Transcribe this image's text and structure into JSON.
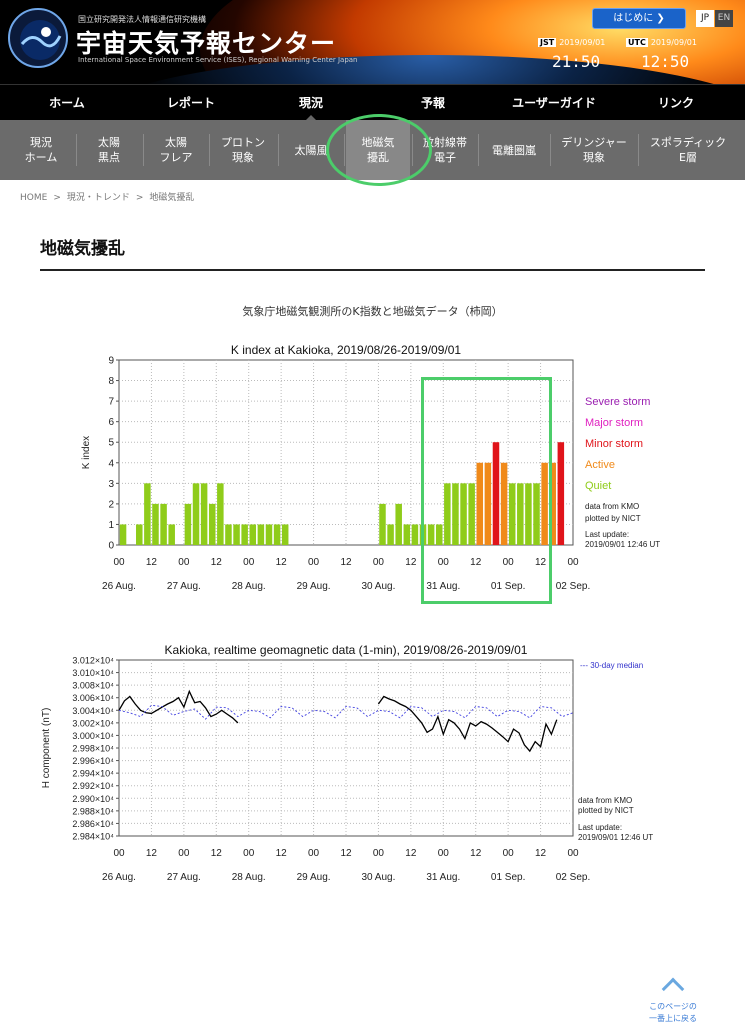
{
  "header": {
    "org": "国立研究開発法人情報通信研究機構",
    "title": "宇宙天気予報センター",
    "subtitle": "International Space Environment Service (ISES), Regional Warning Center Japan",
    "start_button": "はじめに",
    "lang_jp": "JP",
    "lang_en": "EN",
    "jst_tag": "JST",
    "jst_date": "2019/09/01",
    "jst_time": "21:50",
    "utc_tag": "UTC",
    "utc_date": "2019/09/01",
    "utc_time": "12:50"
  },
  "nav": [
    "ホーム",
    "レポート",
    "現況",
    "予報",
    "ユーザーガイド",
    "リンク"
  ],
  "subnav": [
    "現況\nホーム",
    "太陽\n黒点",
    "太陽\nフレア",
    "プロトン\n現象",
    "太陽風",
    "地磁気\n擾乱",
    "放射線帯\n電子",
    "電離圏嵐",
    "デリンジャー\n現象",
    "スポラディック\nE層"
  ],
  "breadcrumb": [
    "HOME",
    ">",
    "現況・トレンド",
    ">",
    "地磁気擾乱"
  ],
  "page_title": "地磁気擾乱",
  "caption": "気象庁地磁気観測所のK指数と地磁気データ（柿岡）",
  "scroll_top": [
    "このページの",
    "一番上に戻る"
  ],
  "chart_data": [
    {
      "type": "bar",
      "title": "K index at Kakioka, 2019/08/26-2019/09/01",
      "ylabel": "K index",
      "ylim": [
        0,
        9
      ],
      "yticks": [
        0,
        1,
        2,
        3,
        4,
        5,
        6,
        7,
        8,
        9
      ],
      "xticks": [
        "00",
        "12",
        "00",
        "12",
        "00",
        "12",
        "00",
        "12",
        "00",
        "12",
        "00",
        "12",
        "00",
        "12",
        "00"
      ],
      "days": [
        "26 Aug.",
        "27 Aug.",
        "28 Aug.",
        "29 Aug.",
        "30 Aug.",
        "31 Aug.",
        "01 Sep.",
        "02 Sep."
      ],
      "values": [
        1,
        0,
        1,
        3,
        2,
        2,
        1,
        0,
        2,
        3,
        3,
        2,
        3,
        1,
        1,
        1,
        1,
        1,
        1,
        1,
        1,
        0,
        0,
        0,
        0,
        0,
        0,
        0,
        0,
        0,
        0,
        0,
        2,
        1,
        2,
        1,
        1,
        1,
        1,
        1,
        3,
        3,
        3,
        3,
        4,
        4,
        5,
        4,
        3,
        3,
        3,
        3,
        4,
        4,
        5
      ],
      "levels": [
        {
          "name": "Severe storm",
          "color": "#9a1fb0"
        },
        {
          "name": "Major storm",
          "color": "#e020c0"
        },
        {
          "name": "Minor storm",
          "color": "#e0141a"
        },
        {
          "name": "Active",
          "color": "#f08a1a"
        },
        {
          "name": "Quiet",
          "color": "#8fcc1a"
        }
      ],
      "notes": [
        "data from KMO",
        "plotted by NICT",
        "Last update:",
        "2019/09/01 12:46 UT"
      ],
      "grid": true
    },
    {
      "type": "line",
      "title": "Kakioka, realtime geomagnetic data (1-min), 2019/08/26-2019/09/01",
      "ylabel": "H component (nT)",
      "ylim": [
        29840,
        30120
      ],
      "yticks": [
        "3.012×10⁴",
        "3.010×10⁴",
        "3.008×10⁴",
        "3.006×10⁴",
        "3.004×10⁴",
        "3.002×10⁴",
        "3.000×10⁴",
        "2.998×10⁴",
        "2.996×10⁴",
        "2.994×10⁴",
        "2.992×10⁴",
        "2.990×10⁴",
        "2.988×10⁴",
        "2.986×10⁴",
        "2.984×10⁴"
      ],
      "xticks": [
        "00",
        "12",
        "00",
        "12",
        "00",
        "12",
        "00",
        "12",
        "00",
        "12",
        "00",
        "12",
        "00",
        "12",
        "00"
      ],
      "days": [
        "26 Aug.",
        "27 Aug.",
        "28 Aug.",
        "29 Aug.",
        "30 Aug.",
        "31 Aug.",
        "01 Sep.",
        "02 Sep."
      ],
      "legend": "--- 30-day median",
      "series": [
        {
          "x": [
            0,
            2,
            4,
            6,
            8,
            10,
            12,
            14,
            16,
            18,
            20,
            22,
            24,
            26,
            28,
            30,
            32,
            34,
            36,
            38,
            40,
            42,
            44,
            46,
            48,
            50,
            52,
            54,
            56,
            58,
            60,
            62,
            64,
            66,
            68,
            70,
            72,
            74,
            76,
            78,
            80,
            82,
            84,
            86,
            88,
            90,
            92,
            94,
            96,
            98,
            100,
            102,
            104,
            106,
            108,
            110,
            112,
            114,
            116,
            118,
            120,
            122,
            124,
            126,
            128,
            130,
            132,
            134,
            136,
            138,
            140,
            142,
            144,
            146,
            148,
            150,
            152,
            154,
            156,
            158,
            160,
            162,
            164,
            166
          ],
          "values": [
            30040,
            30055,
            30062,
            30050,
            30040,
            30036,
            30035,
            30040,
            30045,
            30050,
            30054,
            30060,
            30045,
            30070,
            30052,
            30054,
            30044,
            30030,
            30034,
            30040,
            30034,
            30028,
            30020,
            null,
            null,
            null,
            null,
            null,
            null,
            null,
            null,
            null,
            null,
            null,
            null,
            null,
            null,
            null,
            null,
            null,
            null,
            null,
            null,
            null,
            null,
            null,
            null,
            null,
            30050,
            30062,
            30058,
            30055,
            30050,
            30046,
            30040,
            30030,
            30020,
            30005,
            30010,
            30030,
            30002,
            30025,
            30020,
            30010,
            29995,
            30020,
            30015,
            30022,
            30018,
            30012,
            30005,
            29998,
            29990,
            30010,
            30004,
            29985,
            29975,
            29990,
            29982,
            30018,
            30002,
            30025,
            null,
            null
          ],
          "color": "#000000"
        },
        {
          "name": "30-day median",
          "x": [
            0,
            4,
            8,
            12,
            16,
            20,
            24,
            28,
            32,
            36,
            40,
            44,
            48,
            52,
            56,
            60,
            64,
            68,
            72,
            76,
            80,
            84,
            88,
            92,
            96,
            100,
            104,
            108,
            112,
            116,
            120,
            124,
            128,
            132,
            136,
            140,
            144,
            148,
            152,
            156,
            160,
            164,
            168
          ],
          "values": [
            30040,
            30036,
            30030,
            30048,
            30046,
            30032,
            30038,
            30042,
            30026,
            30045,
            30044,
            30030,
            30040,
            30038,
            30028,
            30046,
            30044,
            30030,
            30040,
            30038,
            30028,
            30046,
            30044,
            30030,
            30040,
            30038,
            30028,
            30046,
            30044,
            30030,
            30040,
            30038,
            30028,
            30046,
            30044,
            30030,
            30040,
            30038,
            30028,
            30046,
            30044,
            30030,
            30036
          ],
          "color": "#4040e0"
        }
      ],
      "notes": [
        "data from KMO",
        "plotted by NICT",
        "Last update:",
        "2019/09/01 12:46 UT"
      ],
      "grid": true
    }
  ]
}
